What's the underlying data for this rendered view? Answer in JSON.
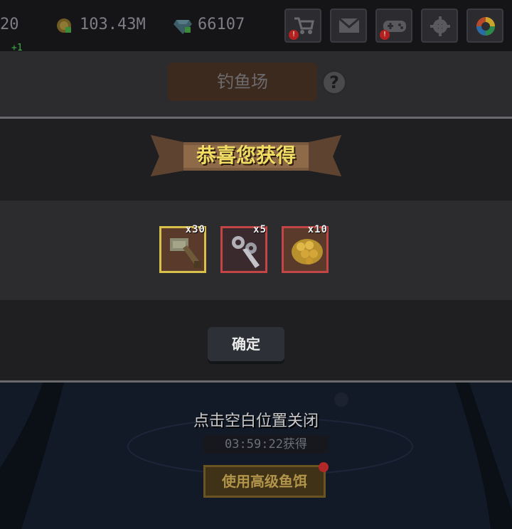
{
  "topbar": {
    "partial_value": "20",
    "gold": "103.43M",
    "gems": "66107",
    "plus_indicator": "+1",
    "buttons": [
      "shop",
      "mail",
      "gamepad",
      "settings",
      "color-wheel"
    ]
  },
  "header": {
    "title": "钓鱼场",
    "help_symbol": "?"
  },
  "modal": {
    "banner_title": "恭喜您获得",
    "rewards": [
      {
        "icon": "hammer-icon",
        "qty": "x30",
        "border": "#d8c14a"
      },
      {
        "icon": "wrench-icon",
        "qty": "x5",
        "border": "#c34545"
      },
      {
        "icon": "golden-scales-icon",
        "qty": "x10",
        "border": "#c34545"
      }
    ],
    "confirm_label": "确定"
  },
  "background": {
    "close_hint": "点击空白位置关闭",
    "timer": "03:59:22获得",
    "bait_button": "使用高级鱼饵"
  }
}
